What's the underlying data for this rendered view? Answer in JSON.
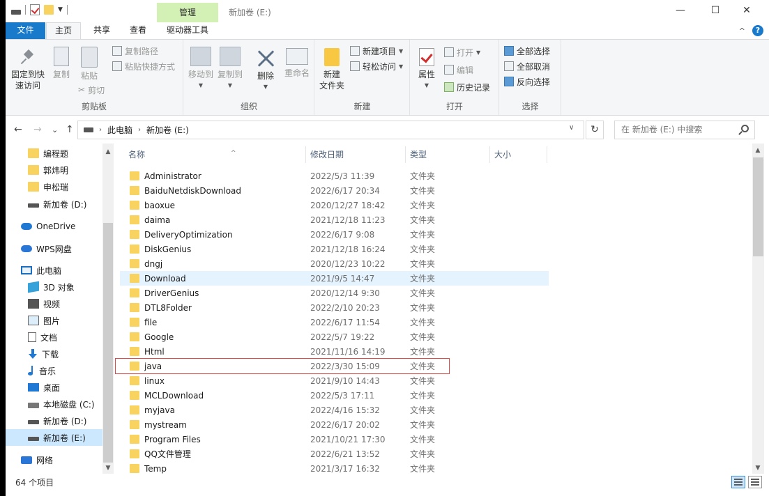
{
  "window": {
    "title": "新加卷 (E:)",
    "manage_tab": "管理",
    "minimize": "—",
    "maximize": "☐",
    "close": "✕"
  },
  "ribbon_tabs": {
    "file": "文件",
    "home": "主页",
    "share": "共享",
    "view": "查看",
    "drive_tools": "驱动器工具",
    "collapse": "^",
    "help": "?"
  },
  "ribbon": {
    "clipboard": {
      "label": "剪贴板",
      "pin_line1": "固定到快",
      "pin_line2": "速访问",
      "copy": "复制",
      "paste": "粘贴",
      "copy_path": "复制路径",
      "paste_shortcut": "粘贴快捷方式",
      "cut": "剪切"
    },
    "organize": {
      "label": "组织",
      "move_to": "移动到",
      "copy_to": "复制到",
      "delete": "删除",
      "rename": "重命名"
    },
    "new": {
      "label": "新建",
      "new_folder_line1": "新建",
      "new_folder_line2": "文件夹",
      "new_item": "新建项目",
      "easy_access": "轻松访问"
    },
    "open": {
      "label": "打开",
      "properties": "属性",
      "open": "打开",
      "edit": "编辑",
      "history": "历史记录"
    },
    "select": {
      "label": "选择",
      "select_all": "全部选择",
      "select_none": "全部取消",
      "invert": "反向选择"
    }
  },
  "address": {
    "back": "←",
    "forward": "→",
    "recent": "⌄",
    "up": "↑",
    "crumb_1": "此电脑",
    "crumb_2": "新加卷 (E:)",
    "refresh": "↻",
    "search_placeholder": "在 新加卷 (E:) 中搜索"
  },
  "nav_pane": [
    {
      "label": "编程题",
      "icon": "folder"
    },
    {
      "label": "郭炜明",
      "icon": "folder"
    },
    {
      "label": "申松瑞",
      "icon": "folder"
    },
    {
      "label": "新加卷 (D:)",
      "icon": "drive"
    },
    {
      "label": "OneDrive",
      "icon": "cloud"
    },
    {
      "label": "WPS网盘",
      "icon": "wps"
    },
    {
      "label": "此电脑",
      "icon": "pc"
    },
    {
      "label": "3D 对象",
      "icon": "cube"
    },
    {
      "label": "视频",
      "icon": "video"
    },
    {
      "label": "图片",
      "icon": "pic"
    },
    {
      "label": "文档",
      "icon": "docs"
    },
    {
      "label": "下载",
      "icon": "down"
    },
    {
      "label": "音乐",
      "icon": "music"
    },
    {
      "label": "桌面",
      "icon": "desk"
    },
    {
      "label": "本地磁盘 (C:)",
      "icon": "cdrive"
    },
    {
      "label": "新加卷 (D:)",
      "icon": "drive"
    },
    {
      "label": "新加卷 (E:)",
      "icon": "drive"
    },
    {
      "label": "网络",
      "icon": "net"
    }
  ],
  "columns": {
    "name": "名称",
    "date": "修改日期",
    "type": "类型",
    "size": "大小"
  },
  "files": [
    {
      "name": "Administrator",
      "date": "2022/5/3 11:39",
      "type": "文件夹"
    },
    {
      "name": "BaiduNetdiskDownload",
      "date": "2022/6/17 20:34",
      "type": "文件夹"
    },
    {
      "name": "baoxue",
      "date": "2020/12/27 18:42",
      "type": "文件夹"
    },
    {
      "name": "daima",
      "date": "2021/12/18 11:23",
      "type": "文件夹"
    },
    {
      "name": "DeliveryOptimization",
      "date": "2022/6/17 9:08",
      "type": "文件夹"
    },
    {
      "name": "DiskGenius",
      "date": "2021/12/18 16:24",
      "type": "文件夹"
    },
    {
      "name": "dngj",
      "date": "2020/12/23 10:22",
      "type": "文件夹"
    },
    {
      "name": "Download",
      "date": "2021/9/5 14:47",
      "type": "文件夹"
    },
    {
      "name": "DriverGenius",
      "date": "2020/12/14 9:30",
      "type": "文件夹"
    },
    {
      "name": "DTL8Folder",
      "date": "2022/2/10 20:23",
      "type": "文件夹"
    },
    {
      "name": "file",
      "date": "2022/6/17 11:54",
      "type": "文件夹"
    },
    {
      "name": "Google",
      "date": "2022/5/7 19:22",
      "type": "文件夹"
    },
    {
      "name": "Html",
      "date": "2021/11/16 14:19",
      "type": "文件夹"
    },
    {
      "name": "java",
      "date": "2022/3/30 15:09",
      "type": "文件夹"
    },
    {
      "name": "linux",
      "date": "2021/9/10 14:43",
      "type": "文件夹"
    },
    {
      "name": "MCLDownload",
      "date": "2022/5/3 17:11",
      "type": "文件夹"
    },
    {
      "name": "myjava",
      "date": "2022/4/16 15:32",
      "type": "文件夹"
    },
    {
      "name": "mystream",
      "date": "2022/6/17 20:02",
      "type": "文件夹"
    },
    {
      "name": "Program Files",
      "date": "2021/10/21 17:30",
      "type": "文件夹"
    },
    {
      "name": "QQ文件管理",
      "date": "2022/6/21 13:52",
      "type": "文件夹"
    },
    {
      "name": "Temp",
      "date": "2021/3/17 16:32",
      "type": "文件夹"
    }
  ],
  "status": {
    "count": "64 个项目"
  },
  "colors": {
    "accent": "#1979ca",
    "manage_tab": "#d3f0b5",
    "hover_row": "#e5f3ff",
    "selected_nav": "#cce8ff",
    "highlight_outline": "#e04848",
    "folder": "#f8d35f"
  }
}
